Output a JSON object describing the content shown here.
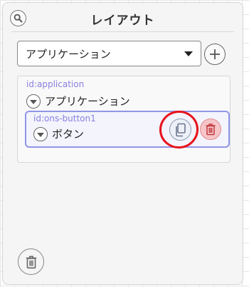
{
  "header": {
    "title": "レイアウト",
    "search_icon": "search-icon"
  },
  "component_select": {
    "selected": "アプリケーション"
  },
  "tree": {
    "root": {
      "id_label": "id:application",
      "name": "アプリケーション"
    },
    "child": {
      "id_label": "id:ons-button1",
      "name": "ボタン",
      "actions": [
        "copy-icon",
        "trash-icon"
      ]
    }
  },
  "footer": {
    "delete_icon": "trash-icon"
  },
  "colors": {
    "id_label": "#8a7fe0",
    "selection_border": "#8f96e8",
    "delete_bg": "#f6c5c8",
    "highlight_ring": "#e8141d"
  }
}
